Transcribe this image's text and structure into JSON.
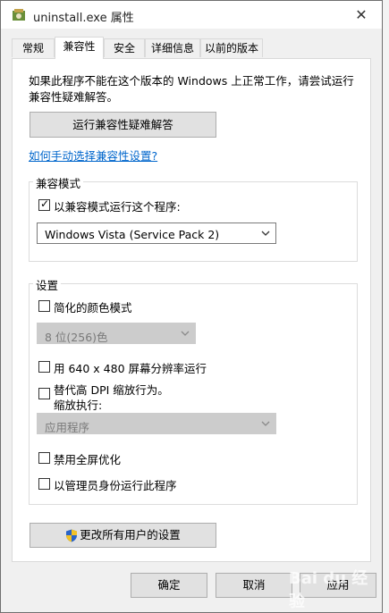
{
  "window": {
    "title": "uninstall.exe 属性",
    "close": "✕"
  },
  "tabs": [
    {
      "label": "常规"
    },
    {
      "label": "兼容性"
    },
    {
      "label": "安全"
    },
    {
      "label": "详细信息"
    },
    {
      "label": "以前的版本"
    }
  ],
  "intro": "如果此程序不能在这个版本的 Windows 上正常工作，请尝试运行兼容性疑难解答。",
  "troubleshoot_button": "运行兼容性疑难解答",
  "manual_link": "如何手动选择兼容性设置?",
  "compat_mode": {
    "group_title": "兼容模式",
    "checkbox_label": "以兼容模式运行这个程序:",
    "checked": true,
    "selected_os": "Windows Vista (Service Pack 2)"
  },
  "settings": {
    "group_title": "设置",
    "reduced_color": "简化的颜色模式",
    "color_depth": "8 位(256)色",
    "res_640": "用 640 x 480 屏幕分辨率运行",
    "dpi_override": "替代高 DPI 缩放行为。",
    "dpi_sub": "缩放执行:",
    "dpi_select": "应用程序",
    "disable_fullscreen": "禁用全屏优化",
    "run_as_admin": "以管理员身份运行此程序"
  },
  "change_all_button": "更改所有用户的设置",
  "footer": {
    "ok": "确定",
    "cancel": "取消",
    "apply": "应用"
  },
  "watermark": "Bai du 经验",
  "colors": {
    "link": "#0066cc",
    "button_bg": "#e1e1e1",
    "panel_bg": "#ffffff",
    "window_bg": "#f0f0f0"
  }
}
